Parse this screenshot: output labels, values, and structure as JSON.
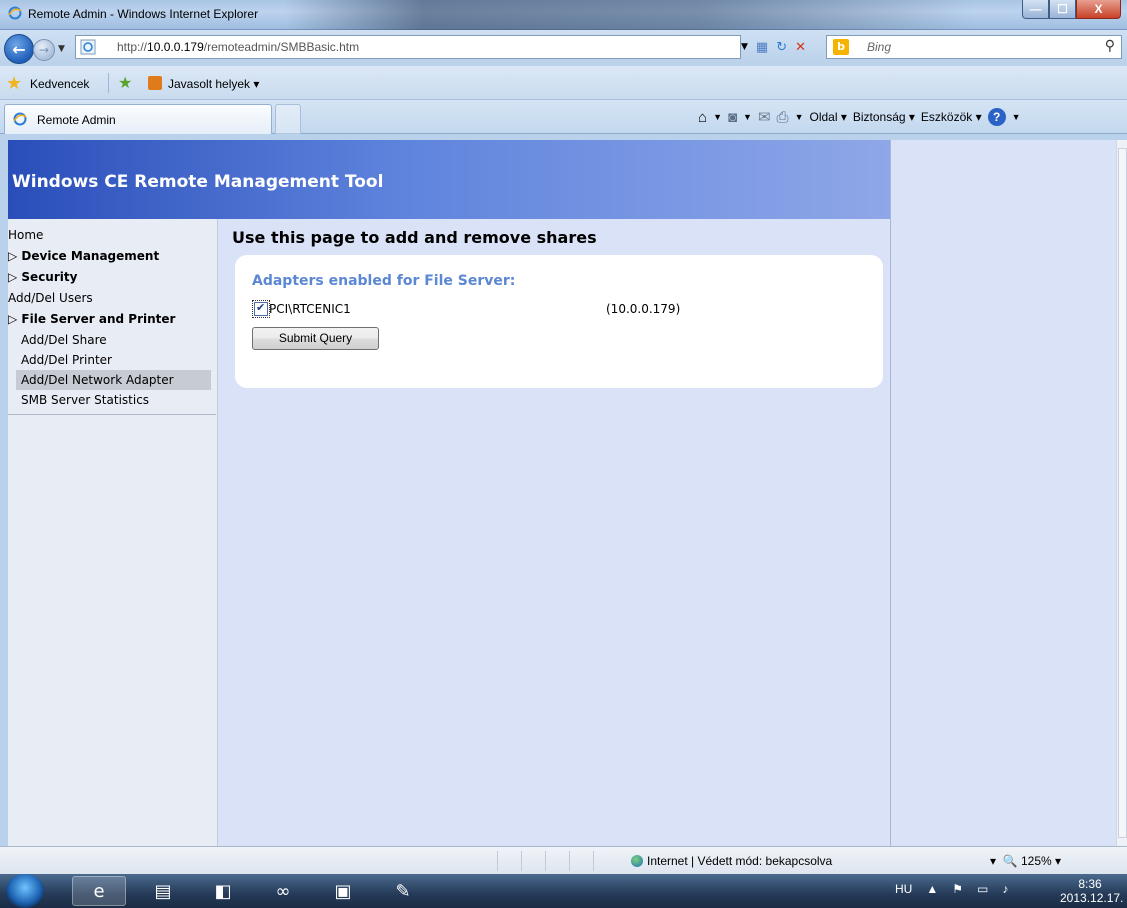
{
  "window": {
    "title": "Remote Admin - Windows Internet Explorer",
    "buttons": {
      "minimize": "—",
      "maximize": "☐",
      "close": "X"
    }
  },
  "address_bar": {
    "url_prefix": "http://",
    "url_host": "10.0.0.179",
    "url_path": "/remoteadmin/SMBBasic.htm",
    "search_placeholder": "Bing"
  },
  "favorites_bar": {
    "favorites_label": "Kedvencek",
    "suggested_label": "Javasolt helyek ▾"
  },
  "tabs": [
    {
      "label": "Remote Admin"
    }
  ],
  "command_bar": {
    "page_label": "Oldal ▾",
    "security_label": "Biztonság ▾",
    "tools_label": "Eszközök ▾"
  },
  "page": {
    "header_title": "Windows CE Remote Management Tool",
    "nav": [
      {
        "label": "Home",
        "style": "plain"
      },
      {
        "label": "▷ Device Management",
        "style": "bold"
      },
      {
        "label": "▷ Security",
        "style": "bold"
      },
      {
        "label": "Add/Del Users",
        "style": "plain"
      },
      {
        "label": "▷ File Server and Printer",
        "style": "bold"
      },
      {
        "label": "Add/Del Share",
        "style": "sub"
      },
      {
        "label": "Add/Del Printer",
        "style": "sub"
      },
      {
        "label": "Add/Del Network Adapter",
        "style": "sub-active"
      },
      {
        "label": "SMB Server Statistics",
        "style": "sub"
      }
    ],
    "heading": "Use this page to add and remove shares",
    "section_title": "Adapters enabled for File Server:",
    "adapter": {
      "name": "PCI\\RTCENIC1",
      "ip": "(10.0.0.179)",
      "checked": true
    },
    "submit_label": "Submit Query"
  },
  "status_bar": {
    "zone_text": "Internet | Védett mód: bekapcsolva",
    "zoom": "125%"
  },
  "taskbar": {
    "language": "HU",
    "time": "8:36",
    "date": "2013.12.17."
  }
}
